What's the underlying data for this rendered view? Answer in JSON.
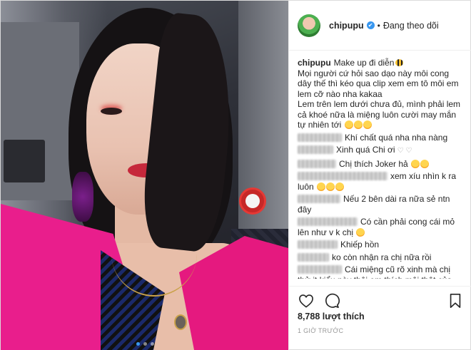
{
  "header": {
    "username": "chipupu",
    "verified_mark": "✔",
    "separator": "•",
    "follow_status": "Đang theo dõi"
  },
  "caption": {
    "username": "chipupu",
    "lines": [
      "Make up đi diễn",
      "Mọi người cứ hỏi sao dạo này môi cong dây thế thì kéo qua clip xem em tô môi em lem cỡ nào nha kakaa",
      "Lem trên lem dưới chưa đủ, mình phải lem cả khoé nữa là miệng luôn cười may mắn tự nhiên tới"
    ]
  },
  "comments": [
    {
      "text": "Khí chất quá nha nha nàng"
    },
    {
      "text": "Xinh quá Chi ơi"
    },
    {
      "text": "Chị thích Joker hả"
    },
    {
      "text": "xem xíu nhìn k ra luôn"
    },
    {
      "text": "Nếu 2 bên dài ra nữa sẻ ntn đây"
    },
    {
      "text": "Có cần phải cong cái mỏ lên như v k chị"
    },
    {
      "text": "Khiếp hồn"
    },
    {
      "text": "ko còn nhận ra chị nữa rồi"
    },
    {
      "text": "Cái miệng cũ rõ xinh mà chị thử it kiểu này thôi em thích môi thật của chị cơ"
    }
  ],
  "actions": {
    "like_icon": "heart-outline-icon",
    "comment_icon": "comment-bubble-icon",
    "save_icon": "bookmark-icon"
  },
  "stats": {
    "likes": "8,788 lượt thích",
    "time": "1 GIỜ TRƯỚC"
  },
  "colors": {
    "verified": "#3897f0",
    "text": "#262626",
    "muted": "#999999",
    "border": "#dbdbdb"
  }
}
